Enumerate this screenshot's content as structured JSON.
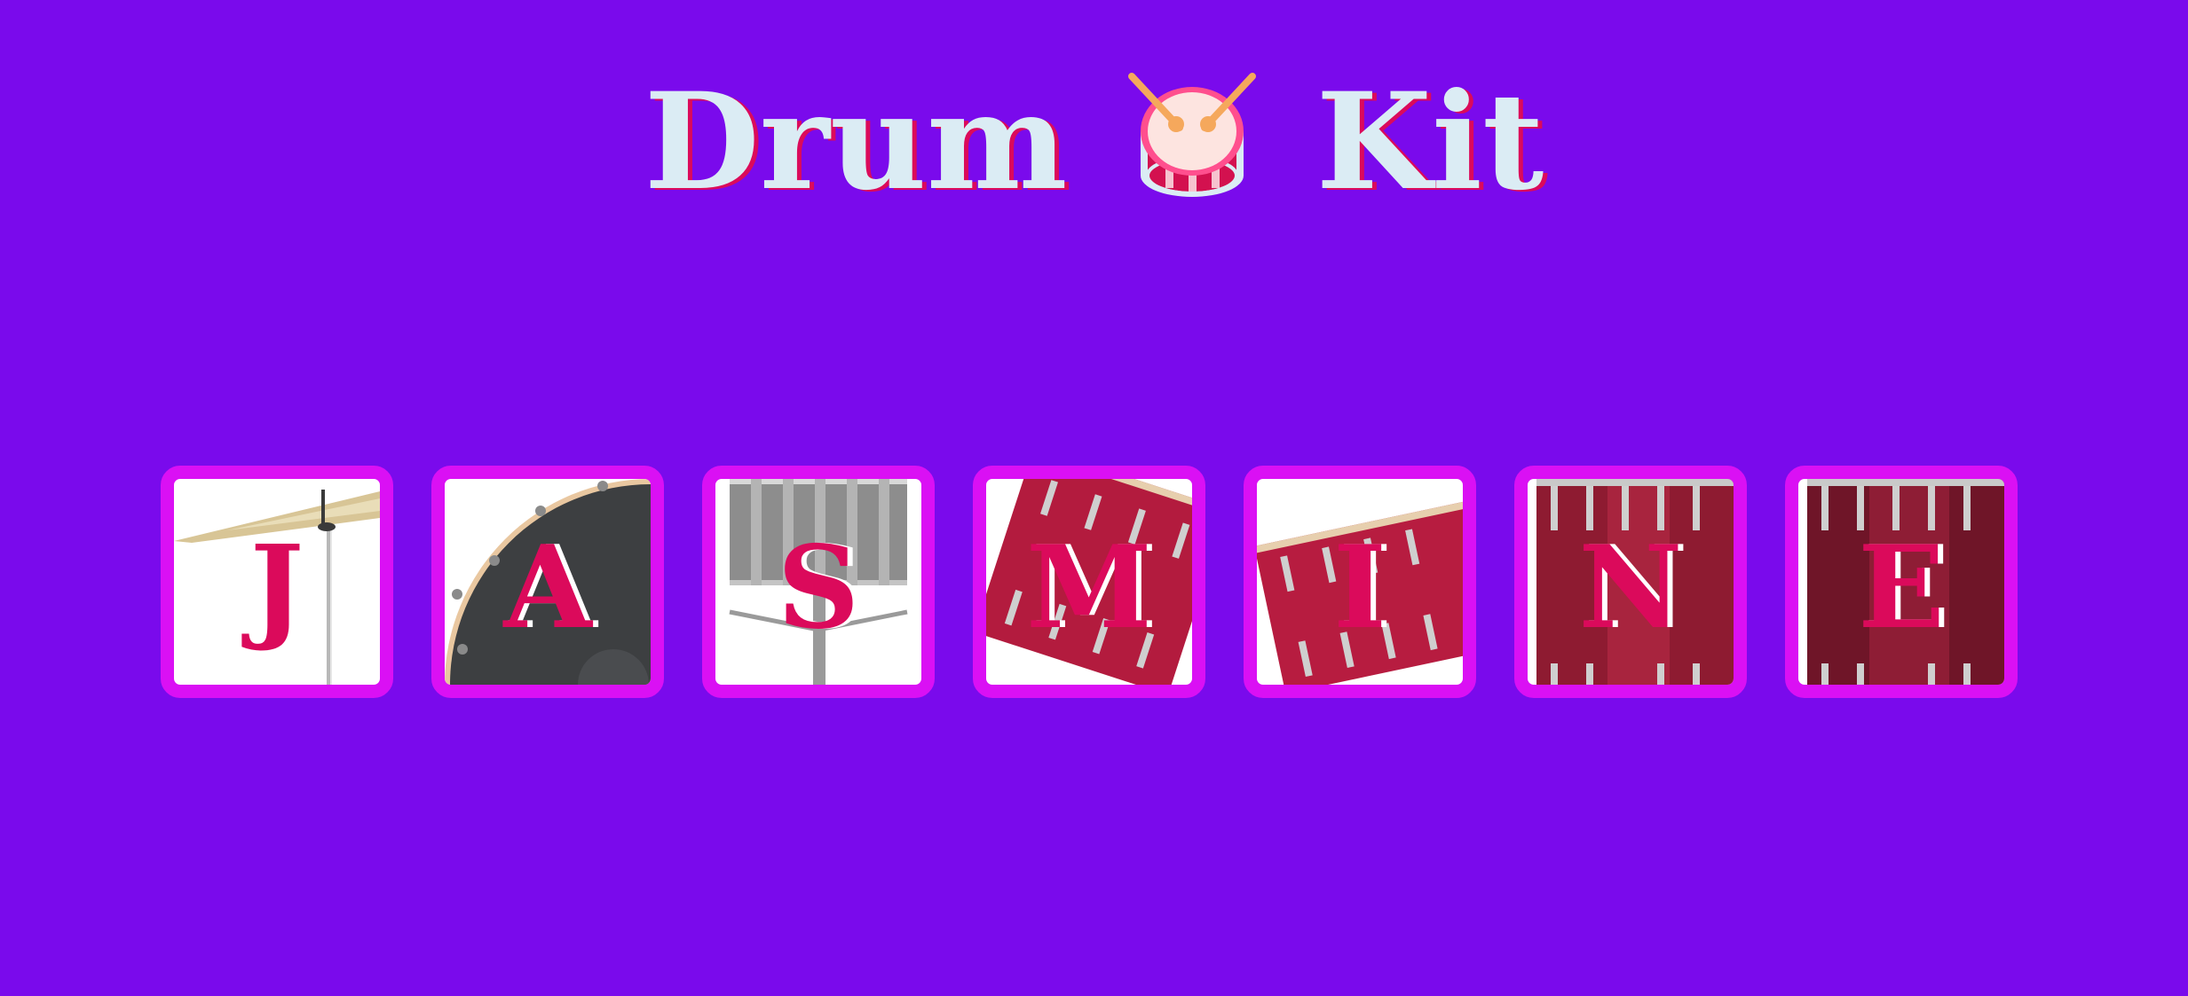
{
  "header": {
    "title_left": "Drum",
    "title_icon": "drum-icon",
    "title_right": "Kit"
  },
  "drums": [
    {
      "letter": "J",
      "art": "crash-cymbal"
    },
    {
      "letter": "A",
      "art": "kick-drum"
    },
    {
      "letter": "S",
      "art": "snare-drum"
    },
    {
      "letter": "M",
      "art": "tom-1"
    },
    {
      "letter": "I",
      "art": "tom-2"
    },
    {
      "letter": "N",
      "art": "tom-3"
    },
    {
      "letter": "E",
      "art": "tom-4"
    }
  ],
  "colors": {
    "background": "#7a0aec",
    "title_text": "#dbecf4",
    "title_shadow": "#db0a5b",
    "button_border": "#da10f4",
    "letter": "#db0a5b"
  }
}
